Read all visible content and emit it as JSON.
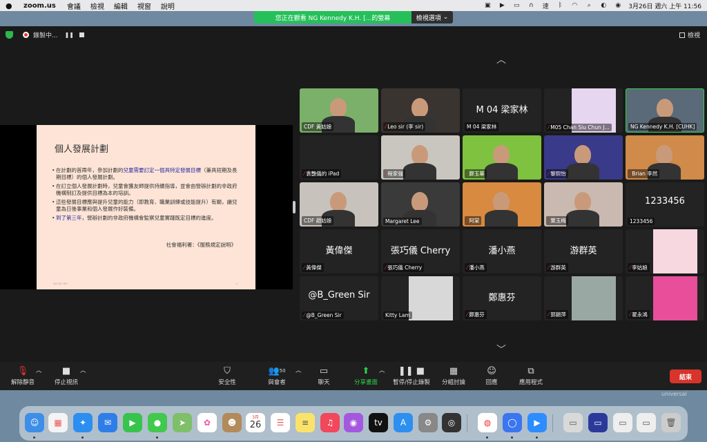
{
  "menubar": {
    "app": "zoom.us",
    "menus": [
      "會議",
      "檢視",
      "編輯",
      "視窗",
      "說明"
    ],
    "clock": "3月26日 週六 上午 11:56",
    "input_badge": "速"
  },
  "share_banner": {
    "message": "您正在觀看 NG Kennedy K.H. [...的螢幕",
    "options_label": "檢視選項"
  },
  "topstrip": {
    "recording_label": "錄製中...",
    "view_label": "檢視"
  },
  "slide": {
    "title": "個人發展計劃",
    "bullets": [
      {
        "pre": "在計劃的首兩年，參加計劃的",
        "hl": "兒童需要訂定一個具特定發展目標",
        "post": "（兼具短期及長期目標）的個人發展計劃。"
      },
      {
        "pre": "在訂立個人發展計劃時，兒童會獲友師提供持續指導，並會由營辦計劃的非政府機構制訂及提供目標為本的培訓。",
        "hl": "",
        "post": ""
      },
      {
        "pre": "這些發展目標應與提升兒童的能力（即教育、職業訓練或技能提升）有關，讓兒童為日後事業和個人發展作好裝備。",
        "hl": "",
        "post": ""
      },
      {
        "pre": "",
        "hl": "到了第三年",
        "post": "，營辦計劃的非政府機構會監察兒童實踐既定目標的進度。"
      }
    ],
    "source": "社會福利署：《服務規定說明》",
    "footer": "SO SO SO",
    "page": "2"
  },
  "gallery": {
    "tiles": [
      {
        "name": "CDF 黃姑娘",
        "big": "",
        "muted": false,
        "bg": "#7bb06a"
      },
      {
        "name": "Leo sir (李 sir)",
        "big": "",
        "muted": true,
        "bg": "#3a3430"
      },
      {
        "name": "M 04 梁家林",
        "big": "M 04 梁家林",
        "muted": false,
        "bg": "#232323"
      },
      {
        "name": "M05 Chan Siu Chun J...",
        "big": "",
        "muted": true,
        "bg": "#232323"
      },
      {
        "name": "NG Kennedy K.H. [CUHK]",
        "big": "",
        "muted": false,
        "bg": "#5a6a78"
      },
      {
        "name": "袁艷儀的 iPad",
        "big": "",
        "muted": true,
        "bg": "#232323"
      },
      {
        "name": "程家強",
        "big": "",
        "muted": true,
        "bg": "#c9c6c0"
      },
      {
        "name": "鄭玉華",
        "big": "",
        "muted": true,
        "bg": "#7fc23f"
      },
      {
        "name": "黎熙怡",
        "big": "",
        "muted": true,
        "bg": "#3a3a8a"
      },
      {
        "name": "Brian 李然",
        "big": "",
        "muted": true,
        "bg": "#d08a4a"
      },
      {
        "name": "CDF 趙姑娘",
        "big": "",
        "muted": false,
        "bg": "#c8c2bc"
      },
      {
        "name": "Margaret Lee",
        "big": "",
        "muted": false,
        "bg": "#3a3a3a"
      },
      {
        "name": "阿棠",
        "big": "",
        "muted": true,
        "bg": "#d88a40"
      },
      {
        "name": "葉玉梅",
        "big": "",
        "muted": true,
        "bg": "#c9b9b0"
      },
      {
        "name": "1233456",
        "big": "1233456",
        "muted": false,
        "bg": "#232323"
      },
      {
        "name": "黃偉傑",
        "big": "黃偉傑",
        "muted": true,
        "bg": "#232323"
      },
      {
        "name": "張巧儀 Cherry",
        "big": "張巧儀 Cherry",
        "muted": true,
        "bg": "#232323"
      },
      {
        "name": "潘小燕",
        "big": "潘小燕",
        "muted": true,
        "bg": "#232323"
      },
      {
        "name": "游群英",
        "big": "游群英",
        "muted": true,
        "bg": "#232323"
      },
      {
        "name": "李姑娘",
        "big": "",
        "muted": true,
        "bg": "#232323"
      },
      {
        "name": "@B_Green Sir",
        "big": "@B_Green Sir",
        "muted": true,
        "bg": "#232323"
      },
      {
        "name": "Kitty Lam",
        "big": "",
        "muted": false,
        "bg": "#232323"
      },
      {
        "name": "鄭惠芬",
        "big": "鄭惠芬",
        "muted": true,
        "bg": "#232323"
      },
      {
        "name": "郭錦萍",
        "big": "",
        "muted": true,
        "bg": "#232323"
      },
      {
        "name": "翟永鴻",
        "big": "",
        "muted": true,
        "bg": "#232323"
      }
    ]
  },
  "toolbar": {
    "unmute": "解除靜音",
    "stop_video": "停止視訊",
    "security": "安全性",
    "participants": "與會者",
    "participant_count": "50",
    "chat": "聊天",
    "share_screen": "分享畫面",
    "pause_recording": "暫停/停止錄製",
    "breakout": "分組討論",
    "reactions": "回應",
    "apps": "應用程式",
    "end": "結束"
  },
  "watermark": "universal",
  "dock": {
    "calendar_month": "3月",
    "calendar_day": "26"
  }
}
